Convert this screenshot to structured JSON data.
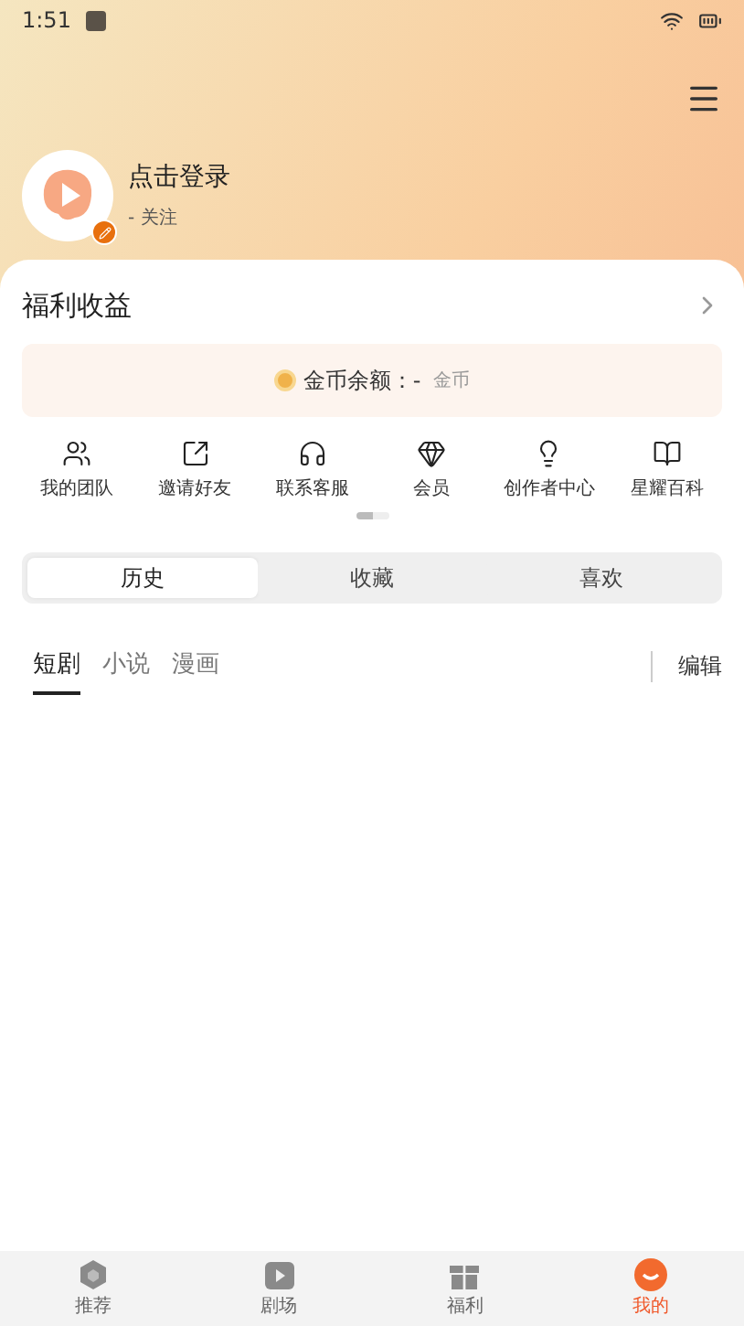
{
  "status_bar": {
    "time": "1:51"
  },
  "profile": {
    "name": "点击登录",
    "follow": "- 关注"
  },
  "earnings": {
    "title": "福利收益",
    "coin_label": "金币余额：",
    "coin_value": "-",
    "coin_unit": "金币"
  },
  "shortcuts": [
    {
      "label": "我的团队"
    },
    {
      "label": "邀请好友"
    },
    {
      "label": "联系客服"
    },
    {
      "label": "会员"
    },
    {
      "label": "创作者中心"
    },
    {
      "label": "星耀百科"
    }
  ],
  "tabs": [
    {
      "label": "历史",
      "selected": true
    },
    {
      "label": "收藏",
      "selected": false
    },
    {
      "label": "喜欢",
      "selected": false
    }
  ],
  "sub_tabs": [
    {
      "label": "短剧",
      "selected": true
    },
    {
      "label": "小说",
      "selected": false
    },
    {
      "label": "漫画",
      "selected": false
    }
  ],
  "edit_label": "编辑",
  "nav": [
    {
      "label": "推荐",
      "selected": false
    },
    {
      "label": "剧场",
      "selected": false
    },
    {
      "label": "福利",
      "selected": false
    },
    {
      "label": "我的",
      "selected": true
    }
  ]
}
